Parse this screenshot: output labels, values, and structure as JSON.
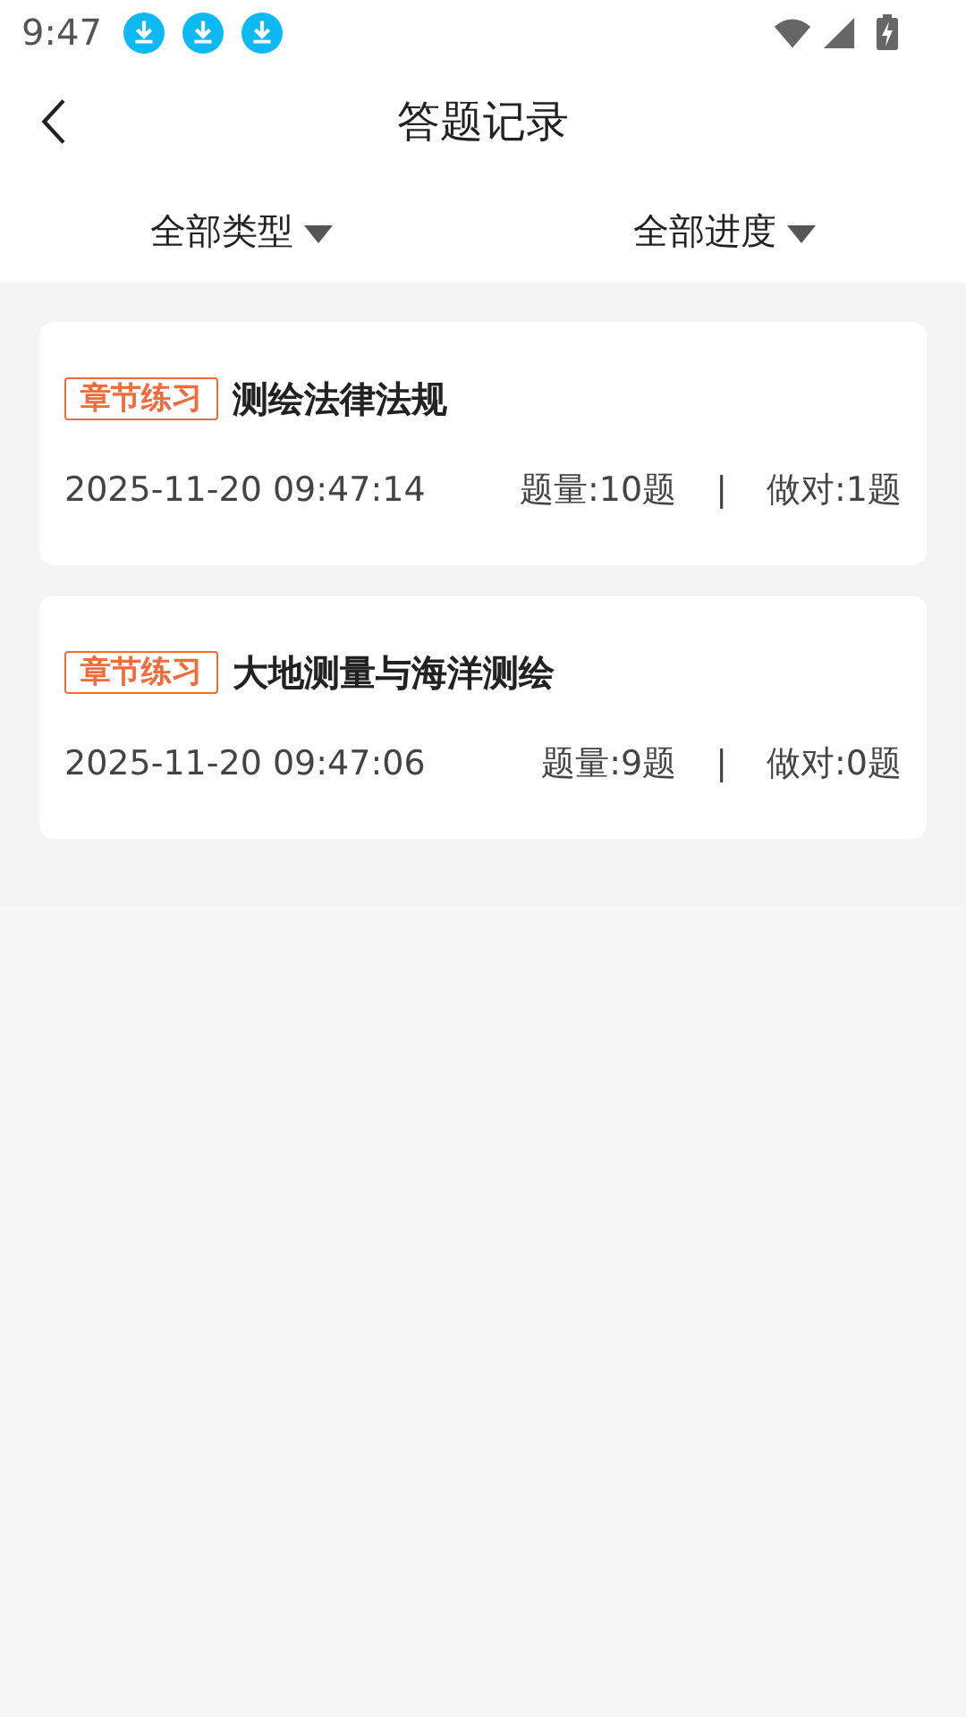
{
  "status_bar": {
    "time": "9:47",
    "notifications": [
      {
        "kind": "download"
      },
      {
        "kind": "download"
      },
      {
        "kind": "download"
      }
    ]
  },
  "header": {
    "title": "答题记录"
  },
  "filters": [
    {
      "label": "全部类型"
    },
    {
      "label": "全部进度"
    }
  ],
  "records": [
    {
      "tag": "章节练习",
      "title": "测绘法律法规",
      "time": "2025-11-20 09:47:14",
      "count": "题量:10题",
      "separator": "|",
      "correct": "做对:1题"
    },
    {
      "tag": "章节练习",
      "title": "大地测量与海洋测绘",
      "time": "2025-11-20 09:47:06",
      "count": "题量:9题",
      "separator": "|",
      "correct": "做对:0题"
    }
  ]
}
